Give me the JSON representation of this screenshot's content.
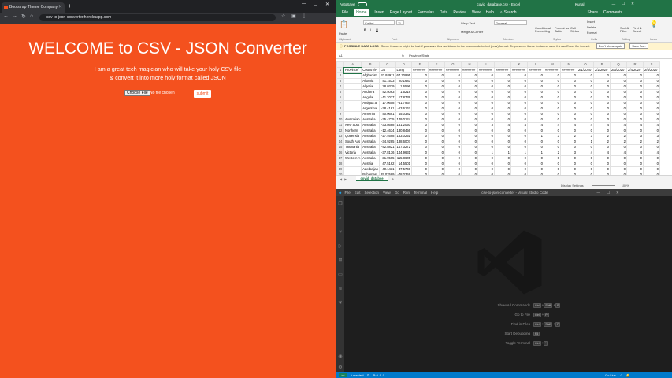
{
  "browser": {
    "tab_title": "Bootstrap Theme Company",
    "url": "csv-to-json-converter.herokuapp.com",
    "heading": "WELCOME to CSV - JSON Converter",
    "tagline1": "I am a great tech magician who will take your holy CSV file",
    "tagline2": "& convert it into more holy format called JSON",
    "choose_label": "Choose File",
    "no_file": "No file chosen",
    "submit": "submit"
  },
  "excel": {
    "autosave": "AutoSave",
    "title": "covid_database.csv - Excel",
    "user": "Kunal",
    "search": "Search",
    "menu": [
      "File",
      "Home",
      "Insert",
      "Page Layout",
      "Formulas",
      "Data",
      "Review",
      "View",
      "Help"
    ],
    "share": "Share",
    "comments": "Comments",
    "groups": [
      "Clipboard",
      "Font",
      "Alignment",
      "Number",
      "Styles",
      "Cells",
      "Editing",
      "Ideas"
    ],
    "font_name": "Calibri",
    "font_size": "11",
    "number_fmt": "General",
    "wrap": "Wrap Text",
    "merge": "Merge & Center",
    "cond": "Conditional Formatting",
    "fmt_table": "Format as Table",
    "cell_styles": "Cell Styles",
    "insert": "Insert",
    "delete": "Delete",
    "format": "Format",
    "sort": "Sort & Filter",
    "find": "Find & Select",
    "paste": "Paste",
    "warn_label": "POSSIBLE DATA LOSS",
    "warn_text": "Some features might be lost if you save this workbook in the comma-delimited (.csv) format. To preserve these features, save it in an Excel file format.",
    "dont_show": "Don't show again",
    "save_as": "Save As...",
    "namebox": "A1",
    "formula": "Province/State",
    "col_headers": [
      "",
      "A",
      "B",
      "C",
      "D",
      "E",
      "F",
      "G",
      "H",
      "I",
      "J",
      "K",
      "L",
      "M",
      "N",
      "O",
      "P",
      "Q",
      "R",
      "S"
    ],
    "rows": [
      [
        "1",
        "Province/",
        "Country/R",
        "Lat",
        "Long",
        "#######",
        "#######",
        "#######",
        "#######",
        "#######",
        "#######",
        "#######",
        "#######",
        "#######",
        "#######",
        "2/1/2020",
        "2/2/2020",
        "2/3/2020",
        "2/4/2020",
        "2/5/2020"
      ],
      [
        "2",
        "",
        "Afghanist",
        "33.93911",
        "67.70995",
        "0",
        "0",
        "0",
        "0",
        "0",
        "0",
        "0",
        "0",
        "0",
        "0",
        "0",
        "0",
        "0",
        "0",
        "0"
      ],
      [
        "3",
        "",
        "Albania",
        "41.1533",
        "20.1683",
        "0",
        "0",
        "0",
        "0",
        "0",
        "0",
        "0",
        "0",
        "0",
        "0",
        "0",
        "0",
        "0",
        "0",
        "0"
      ],
      [
        "4",
        "",
        "Algeria",
        "28.0339",
        "1.6596",
        "0",
        "0",
        "0",
        "0",
        "0",
        "0",
        "0",
        "0",
        "0",
        "0",
        "0",
        "0",
        "0",
        "0",
        "0"
      ],
      [
        "5",
        "",
        "Andorra",
        "42.5063",
        "1.5218",
        "0",
        "0",
        "0",
        "0",
        "0",
        "0",
        "0",
        "0",
        "0",
        "0",
        "0",
        "0",
        "0",
        "0",
        "0"
      ],
      [
        "6",
        "",
        "Angola",
        "-11.2027",
        "17.8739",
        "0",
        "0",
        "0",
        "0",
        "0",
        "0",
        "0",
        "0",
        "0",
        "0",
        "0",
        "0",
        "0",
        "0",
        "0"
      ],
      [
        "7",
        "",
        "Antigua ar",
        "17.0608",
        "-61.7964",
        "0",
        "0",
        "0",
        "0",
        "0",
        "0",
        "0",
        "0",
        "0",
        "0",
        "0",
        "0",
        "0",
        "0",
        "0"
      ],
      [
        "8",
        "",
        "Argentina",
        "-38.4161",
        "-63.6167",
        "0",
        "0",
        "0",
        "0",
        "0",
        "0",
        "0",
        "0",
        "0",
        "0",
        "0",
        "0",
        "0",
        "0",
        "0"
      ],
      [
        "9",
        "",
        "Armenia",
        "40.0691",
        "45.0382",
        "0",
        "0",
        "0",
        "0",
        "0",
        "0",
        "0",
        "0",
        "0",
        "0",
        "0",
        "0",
        "0",
        "0",
        "0"
      ],
      [
        "10",
        "Australian",
        "Australia",
        "-35.4735",
        "149.0124",
        "0",
        "0",
        "0",
        "0",
        "0",
        "0",
        "0",
        "0",
        "0",
        "0",
        "0",
        "0",
        "0",
        "0",
        "0"
      ],
      [
        "11",
        "New Sout",
        "Australia",
        "-33.8688",
        "151.2093",
        "0",
        "0",
        "0",
        "0",
        "3",
        "4",
        "4",
        "4",
        "4",
        "4",
        "4",
        "4",
        "4",
        "4",
        "4"
      ],
      [
        "12",
        "Northern",
        "Australia",
        "-12.4634",
        "130.8456",
        "0",
        "0",
        "0",
        "0",
        "0",
        "0",
        "0",
        "0",
        "0",
        "0",
        "0",
        "0",
        "0",
        "0",
        "0"
      ],
      [
        "13",
        "Queensla",
        "Australia",
        "-27.4698",
        "153.0251",
        "0",
        "0",
        "0",
        "0",
        "0",
        "0",
        "0",
        "1",
        "3",
        "2",
        "3",
        "2",
        "2",
        "3",
        "3"
      ],
      [
        "14",
        "South Aus",
        "Australia",
        "-34.9285",
        "138.6007",
        "0",
        "0",
        "0",
        "0",
        "0",
        "0",
        "0",
        "0",
        "0",
        "0",
        "1",
        "2",
        "2",
        "2",
        "2"
      ],
      [
        "15",
        "Tasmania",
        "Australia",
        "-42.8821",
        "147.3272",
        "0",
        "0",
        "0",
        "0",
        "0",
        "0",
        "0",
        "0",
        "0",
        "0",
        "0",
        "0",
        "0",
        "0",
        "0"
      ],
      [
        "16",
        "Victoria",
        "Australia",
        "-37.8136",
        "144.9631",
        "0",
        "0",
        "0",
        "0",
        "1",
        "1",
        "1",
        "1",
        "2",
        "3",
        "4",
        "4",
        "4",
        "4",
        "4"
      ],
      [
        "17",
        "Western A",
        "Australia",
        "-31.9505",
        "115.8605",
        "0",
        "0",
        "0",
        "0",
        "0",
        "0",
        "0",
        "0",
        "0",
        "0",
        "0",
        "0",
        "0",
        "0",
        "0"
      ],
      [
        "18",
        "",
        "Austria",
        "47.5162",
        "14.5501",
        "0",
        "0",
        "0",
        "0",
        "0",
        "0",
        "0",
        "0",
        "0",
        "0",
        "0",
        "0",
        "0",
        "0",
        "0"
      ],
      [
        "19",
        "",
        "Azerbaijan",
        "40.1431",
        "47.5769",
        "0",
        "0",
        "0",
        "0",
        "0",
        "0",
        "0",
        "0",
        "0",
        "0",
        "0",
        "0",
        "0",
        "0",
        "0"
      ],
      [
        "20",
        "",
        "Bahamas",
        "25.02589",
        "-78.0359",
        "0",
        "0",
        "0",
        "0",
        "0",
        "0",
        "0",
        "0",
        "0",
        "0",
        "0",
        "0",
        "0",
        "0",
        "0"
      ],
      [
        "21",
        "",
        "Bahrain",
        "26.0275",
        "50.55",
        "0",
        "0",
        "0",
        "0",
        "0",
        "0",
        "0",
        "0",
        "0",
        "0",
        "0",
        "0",
        "0",
        "0",
        "0"
      ]
    ],
    "sheet_tab": "covid_databse",
    "display_settings": "Display Settings",
    "zoom": "100%"
  },
  "vscode": {
    "menu": [
      "File",
      "Edit",
      "Selection",
      "View",
      "Go",
      "Run",
      "Terminal",
      "Help"
    ],
    "title": "csv-to-json-converter - Visual Studio Code",
    "shortcuts": [
      {
        "label": "Show All Commands",
        "keys": [
          "Ctrl",
          "+",
          "Shift",
          "+",
          "P"
        ]
      },
      {
        "label": "Go to File",
        "keys": [
          "Ctrl",
          "+",
          "P"
        ]
      },
      {
        "label": "Find in Files",
        "keys": [
          "Ctrl",
          "+",
          "Shift",
          "+",
          "F"
        ]
      },
      {
        "label": "Start Debugging",
        "keys": [
          "F5"
        ]
      },
      {
        "label": "Toggle Terminal",
        "keys": [
          "Ctrl",
          "+",
          "`"
        ]
      }
    ],
    "branch": "master*",
    "sync": "⟳",
    "problems": "⊗ 0 ⚠ 0",
    "golive": "Go Live"
  }
}
